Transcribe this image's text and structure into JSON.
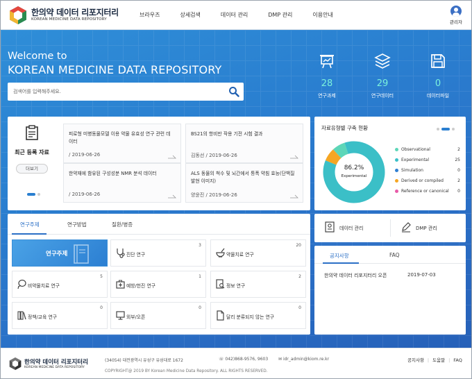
{
  "header": {
    "logo_ko": "한의약 데이터 리포지터리",
    "logo_en": "KOREAN MEDICINE DATA REPOSITORY",
    "nav": [
      "브라우즈",
      "상세검색",
      "데이터 관리",
      "DMP 관리",
      "이용안내"
    ],
    "user_label": "관리자"
  },
  "hero": {
    "welcome": "Welcome to",
    "title": "KOREAN MEDICINE DATA REPOSITORY",
    "search_placeholder": "검색어를 입력해주세요.",
    "stats": [
      {
        "icon": "presentation-icon",
        "value": "28",
        "label": "연구과제"
      },
      {
        "icon": "layers-icon",
        "value": "29",
        "label": "연구데이터"
      },
      {
        "icon": "save-disk-icon",
        "value": "0",
        "label": "데이터파일"
      }
    ]
  },
  "recent": {
    "title": "최근 등록 자료",
    "more": "더보기",
    "items": [
      {
        "title": "피로형 미병동물모델 이용 약물 유효성 연구 관련 데이터",
        "date": "/ 2019-06-26"
      },
      {
        "title": "BS21의 항비만 작용 기전 시험 결과",
        "date": "김동선 / 2019-06-26"
      },
      {
        "title": "한약재에 함유된 구성성분 NMR 분석 데이터",
        "date": "/ 2019-06-26"
      },
      {
        "title": "ALS 동물의 척수 및 뇌간에서 통폭 약침 효능(단백질 발현 이미지)",
        "date": "양윤진 / 2019-06-26"
      }
    ]
  },
  "distribution": {
    "title": "자료유형별 구축 현황",
    "center_pct": "86.2%",
    "center_label": "Experimental",
    "legend": [
      {
        "name": "Observational",
        "count": 2,
        "color": "#5dd6b8"
      },
      {
        "name": "Experimental",
        "count": 25,
        "color": "#3bbfc7"
      },
      {
        "name": "Simulation",
        "count": 0,
        "color": "#2f7fd2"
      },
      {
        "name": "Derived or compiled",
        "count": 2,
        "color": "#f5a623"
      },
      {
        "name": "Reference or canonical",
        "count": 0,
        "color": "#e85aa8"
      }
    ]
  },
  "topics": {
    "tabs": [
      "연구주제",
      "연구방법",
      "질환/병증"
    ],
    "tiles": [
      {
        "label": "연구주제",
        "count": "",
        "icon": "book-icon"
      },
      {
        "label": "진단 연구",
        "count": "3",
        "icon": "stethoscope-icon"
      },
      {
        "label": "약물치료 연구",
        "count": "20",
        "icon": "mortar-icon"
      },
      {
        "label": "비약물치료 연구",
        "count": "5",
        "icon": "cupping-icon"
      },
      {
        "label": "예방/헌진 연구",
        "count": "1",
        "icon": "first-aid-icon"
      },
      {
        "label": "정보 연구",
        "count": "2",
        "icon": "document-search-icon"
      },
      {
        "label": "정책/교육 연구",
        "count": "0",
        "icon": "books-icon"
      },
      {
        "label": "외부/오픈",
        "count": "0",
        "icon": "monitor-icon"
      },
      {
        "label": "달리 분류되지 않는 연구",
        "count": "0",
        "icon": "file-icon"
      }
    ]
  },
  "management": {
    "items": [
      {
        "label": "데이터 관리",
        "icon": "data-manage-icon"
      },
      {
        "label": "DMP 관리",
        "icon": "edit-pencil-icon"
      }
    ]
  },
  "notice": {
    "tabs": [
      "공지사항",
      "FAQ"
    ],
    "rows": [
      {
        "title": "한의약 데이터 리포지터리 오픈",
        "date": "2019-07-03"
      }
    ]
  },
  "footer": {
    "logo_ko": "한의약 데이터 리포지터리",
    "logo_en": "KOREAN MEDICINE DATA REPOSITORY",
    "address": "(34054) 대전광역시 유성구 유성대로 1672",
    "tel": "042)868-9576, 9603",
    "email": "idr_admin@kiom.re.kr",
    "copyright": "COPYRIGHT@ 2019 BY Korean Medicine Data Repository. ALL RIGHTS RESERVED.",
    "links": [
      "공지사항",
      "도움말",
      "FAQ"
    ]
  },
  "colors": {
    "accent": "#2a6fc6",
    "hero_top": "#2f8ed8",
    "hero_bottom": "#2660b8",
    "stat_value": "#7cf2dc"
  }
}
